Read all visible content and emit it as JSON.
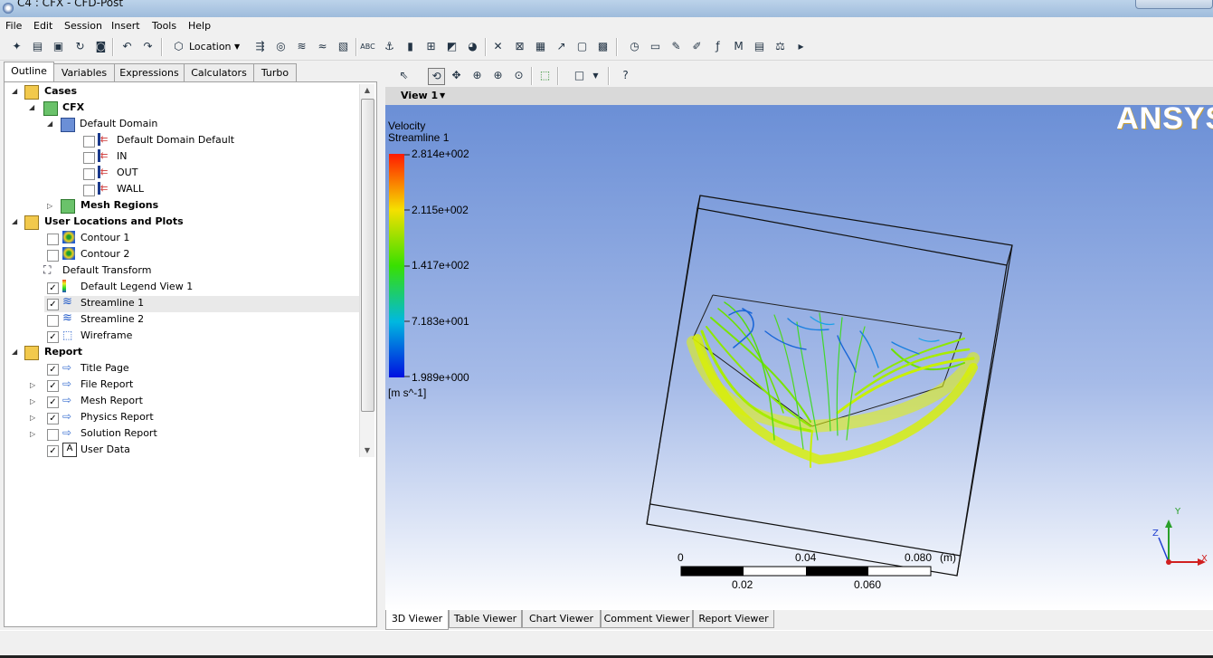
{
  "window": {
    "title": "C4 : CFX - CFD-Post"
  },
  "menu": [
    "File",
    "Edit",
    "Session",
    "Insert",
    "Tools",
    "Help"
  ],
  "toolbar": {
    "location_label": "Location"
  },
  "outline_tabs": [
    "Outline",
    "Variables",
    "Expressions",
    "Calculators",
    "Turbo"
  ],
  "tree": {
    "cases": "Cases",
    "cfx": "CFX",
    "default_domain": "Default Domain",
    "boundaries": [
      {
        "label": "Default Domain Default",
        "checked": false
      },
      {
        "label": "IN",
        "checked": false
      },
      {
        "label": "OUT",
        "checked": false
      },
      {
        "label": "WALL",
        "checked": false
      }
    ],
    "mesh_regions": "Mesh Regions",
    "user_locations": "User Locations and Plots",
    "contour1": "Contour 1",
    "contour2": "Contour 2",
    "default_transform": "Default Transform",
    "legend": "Default Legend View 1",
    "streamline1": "Streamline 1",
    "streamline2": "Streamline 2",
    "wireframe": "Wireframe",
    "report": "Report",
    "title_page": "Title Page",
    "file_report": "File Report",
    "mesh_report": "Mesh Report",
    "physics_report": "Physics Report",
    "solution_report": "Solution Report",
    "user_data": "User Data"
  },
  "viewer": {
    "view_label": "View 1",
    "logo": "ANSYS",
    "legend": {
      "title": "Velocity",
      "subtitle": "Streamline 1",
      "ticks": [
        "2.814e+002",
        "2.115e+002",
        "1.417e+002",
        "7.183e+001",
        "1.989e+000"
      ],
      "units": "[m s^-1]"
    },
    "scale": {
      "top_labels": [
        "0",
        "0.04",
        "0.080"
      ],
      "unit": "(m)",
      "bottom_labels": [
        "0.02",
        "0.060"
      ]
    },
    "axis": {
      "x": "X",
      "y": "Y",
      "z": "Z"
    }
  },
  "bottom_tabs": [
    "3D Viewer",
    "Table Viewer",
    "Chart Viewer",
    "Comment Viewer",
    "Report Viewer"
  ],
  "colors": {
    "viewport_top": "#6b8fd6",
    "viewport_bottom": "#ffffff",
    "streamline_hot": "#e8f000",
    "streamline_green": "#3fdc1c",
    "streamline_blue": "#1860e0"
  }
}
